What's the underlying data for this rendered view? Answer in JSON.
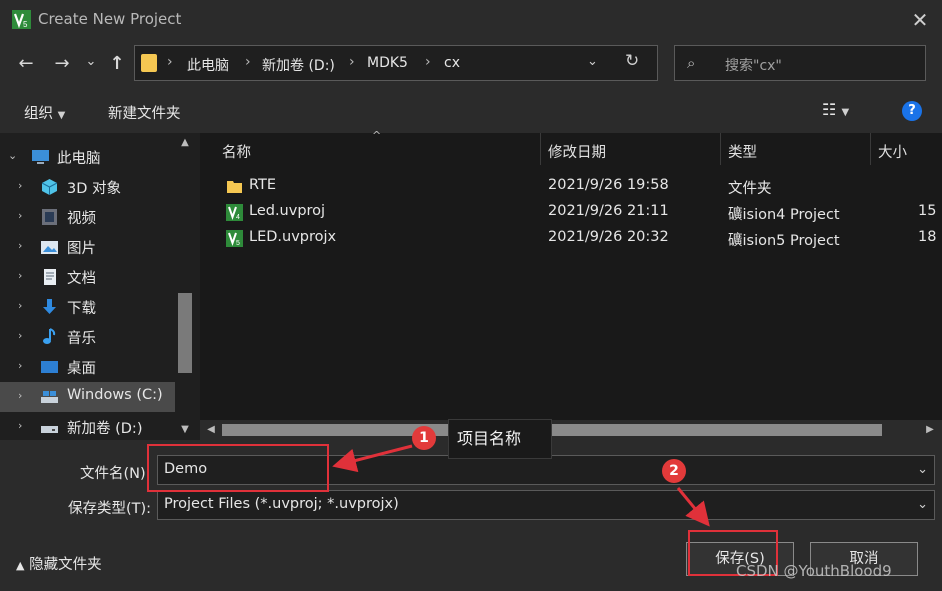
{
  "window": {
    "title": "Create New Project",
    "close_glyph": "✕"
  },
  "nav": {
    "back": "←",
    "forward": "→",
    "recent": "⌄",
    "up": "↑"
  },
  "address": {
    "crumbs": [
      "此电脑",
      "新加卷 (D:)",
      "MDK5",
      "cx"
    ],
    "separator": "›",
    "dropdown": "⌄",
    "refresh": "↻"
  },
  "search": {
    "placeholder": "搜索\"cx\"",
    "icon": "⌕"
  },
  "toolbar": {
    "organize": "组织",
    "new_folder": "新建文件夹",
    "view_icon": "☷",
    "help": "?"
  },
  "sidebar": {
    "items": [
      {
        "label": "此电脑",
        "icon": "pc-icon"
      },
      {
        "label": "3D 对象",
        "icon": "3d-objects-icon"
      },
      {
        "label": "视频",
        "icon": "video-icon"
      },
      {
        "label": "图片",
        "icon": "pictures-icon"
      },
      {
        "label": "文档",
        "icon": "documents-icon"
      },
      {
        "label": "下载",
        "icon": "downloads-icon"
      },
      {
        "label": "音乐",
        "icon": "music-icon"
      },
      {
        "label": "桌面",
        "icon": "desktop-icon"
      },
      {
        "label": "Windows (C:)",
        "icon": "drive-c-icon"
      },
      {
        "label": "新加卷 (D:)",
        "icon": "drive-d-icon"
      }
    ]
  },
  "files": {
    "columns": [
      "名称",
      "修改日期",
      "类型",
      "大小"
    ],
    "rows": [
      {
        "name": "RTE",
        "date": "2021/9/26 19:58",
        "type": "文件夹",
        "size": "",
        "icon": "folder-icon"
      },
      {
        "name": "Led.uvproj",
        "date": "2021/9/26 21:11",
        "type": "礦ision4 Project",
        "size": "15",
        "icon": "uvision-icon"
      },
      {
        "name": "LED.uvprojx",
        "date": "2021/9/26 20:32",
        "type": "礦ision5 Project",
        "size": "18",
        "icon": "uvision-icon"
      }
    ]
  },
  "form": {
    "filename_label": "文件名(N):",
    "filename_value": "Demo",
    "filetype_label": "保存类型(T):",
    "filetype_value": "Project Files (*.uvproj; *.uvprojx)"
  },
  "footer": {
    "hide_folders": "隐藏文件夹",
    "save": "保存(S)",
    "cancel": "取消"
  },
  "annotations": {
    "badge1": "1",
    "badge2": "2",
    "tooltip": "项目名称",
    "watermark": "CSDN @YouthBlood9",
    "color": "#e0313a"
  },
  "colors": {
    "background": "#2b2b2b",
    "panel": "#191919",
    "accent": "#1a73e8",
    "folder": "#f5c752"
  }
}
